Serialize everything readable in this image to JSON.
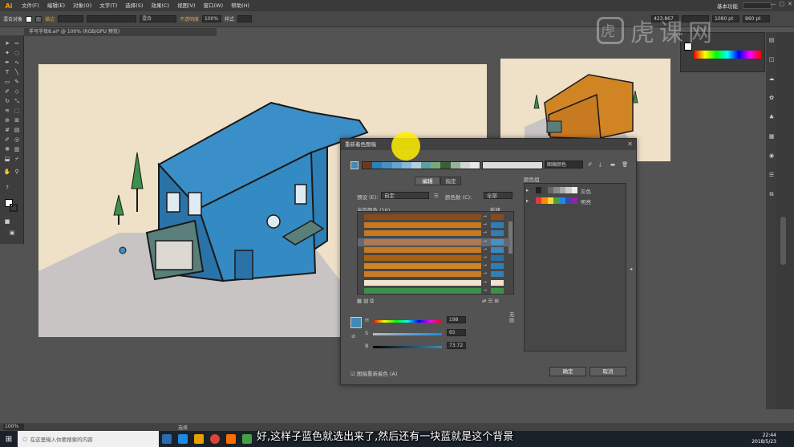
{
  "app": {
    "logo": "Ai"
  },
  "menu": [
    "文件(F)",
    "编辑(E)",
    "对象(O)",
    "文字(T)",
    "选择(S)",
    "效果(C)",
    "视图(V)",
    "窗口(W)",
    "帮助(H)"
  ],
  "workspace": {
    "label": "基本功能"
  },
  "control_bar": {
    "object_label": "混合对象",
    "stroke_label": "描边",
    "blend_mode": "不透明度",
    "opacity": "100%",
    "style_label": "样式",
    "x": "423.867",
    "w": "1080 pt",
    "h": "860 pt",
    "normal_label": "混合"
  },
  "document_tab": {
    "title": "手写字母8.ai* @ 100% (RGB/GPU 预览)"
  },
  "dialog": {
    "title": "重新着色图稿",
    "harmony_name": "图稿颜色",
    "tabs": {
      "edit": "编辑",
      "assign": "指定"
    },
    "preset_label": "预设 (E):",
    "preset_value": "自定",
    "colors_label": "颜色数 (C):",
    "colors_value": "全部",
    "current_colors_label": "当前颜色 (16)",
    "new_label": "新建",
    "color_group_label": "颜色组",
    "groups": [
      {
        "name": "灰色"
      },
      {
        "name": "明亮"
      }
    ],
    "sliders": [
      {
        "label": "H",
        "value": "198"
      },
      {
        "label": "S",
        "value": "65"
      },
      {
        "label": "B",
        "value": "73.72"
      }
    ],
    "none_label": "无",
    "recolor_check": "图稿重新着色 (A)",
    "ok": "确定",
    "cancel": "取消",
    "strip_colors": [
      "#6b3a1e",
      "#2e7fb8",
      "#4a8fc4",
      "#67a3cf",
      "#8ab7d6",
      "#b5cfde",
      "#5f9ea0",
      "#7aa97a",
      "#3a5f3a",
      "#9bb0a0",
      "#cfd8d0",
      "#e8e8e8"
    ],
    "rows": [
      {
        "cur": "#8a4a1c",
        "new": "#8a4a1c"
      },
      {
        "cur": "#c8781e",
        "new": "#2e7fb8"
      },
      {
        "cur": "#c8781e",
        "new": "#2e7fb8"
      },
      {
        "cur": "#b07a50",
        "new": "#4a8fc4"
      },
      {
        "cur": "#c77a22",
        "new": "#3a88c0"
      },
      {
        "cur": "#a86214",
        "new": "#2c6f9e"
      },
      {
        "cur": "#d08424",
        "new": "#2e7fb8"
      },
      {
        "cur": "#c87c26",
        "new": "#357fb0"
      },
      {
        "cur": "#f0e4cf",
        "new": "#f0e4cf"
      },
      {
        "cur": "#3d8f4a",
        "new": "#3d8f4a"
      }
    ],
    "main_color": "#3e8bb8",
    "gray_swatches": [
      "#222",
      "#444",
      "#666",
      "#888",
      "#aaa",
      "#ccc",
      "#eee"
    ],
    "bright_swatches": [
      "#e53935",
      "#fb8c00",
      "#fdd835",
      "#43a047",
      "#1e88e5",
      "#3949ab",
      "#8e24aa"
    ]
  },
  "status": {
    "zoom": "100%",
    "tool": "选择"
  },
  "taskbar": {
    "search_placeholder": "在这里输入你要搜索的内容",
    "time": "22:44",
    "date": "2018/5/23"
  },
  "subtitle": "好,这样子蓝色就选出来了,然后还有一块蓝就是这个背景",
  "watermark": "虎课网"
}
